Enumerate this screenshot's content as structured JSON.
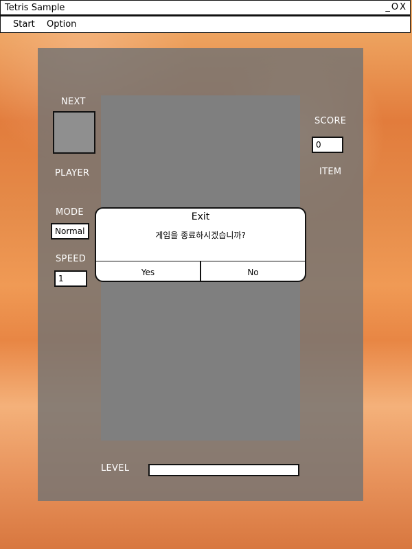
{
  "window": {
    "title": "Tetris Sample",
    "controls": {
      "minimize": "_",
      "maximize": "O",
      "close": "X"
    }
  },
  "menu": {
    "items": [
      {
        "label": "Start"
      },
      {
        "label": "Option"
      }
    ]
  },
  "left_panel": {
    "next_label": "NEXT",
    "player_label": "PLAYER",
    "mode_label": "MODE",
    "mode_value": "Normal",
    "speed_label": "SPEED",
    "speed_value": "1"
  },
  "right_panel": {
    "score_label": "SCORE",
    "score_value": "0",
    "item_label": "ITEM"
  },
  "bottom": {
    "level_label": "LEVEL",
    "level_progress": 0
  },
  "dialog": {
    "title": "Exit",
    "message": "게임을 종료하시겠습니까?",
    "yes_label": "Yes",
    "no_label": "No"
  },
  "colors": {
    "panel": "#737373",
    "board": "#7f7f7f",
    "next_box": "#8f8f8f",
    "background_accent": "#e27c3c"
  },
  "icons": {
    "minimize": "minimize-icon",
    "maximize": "maximize-icon",
    "close": "close-icon"
  }
}
